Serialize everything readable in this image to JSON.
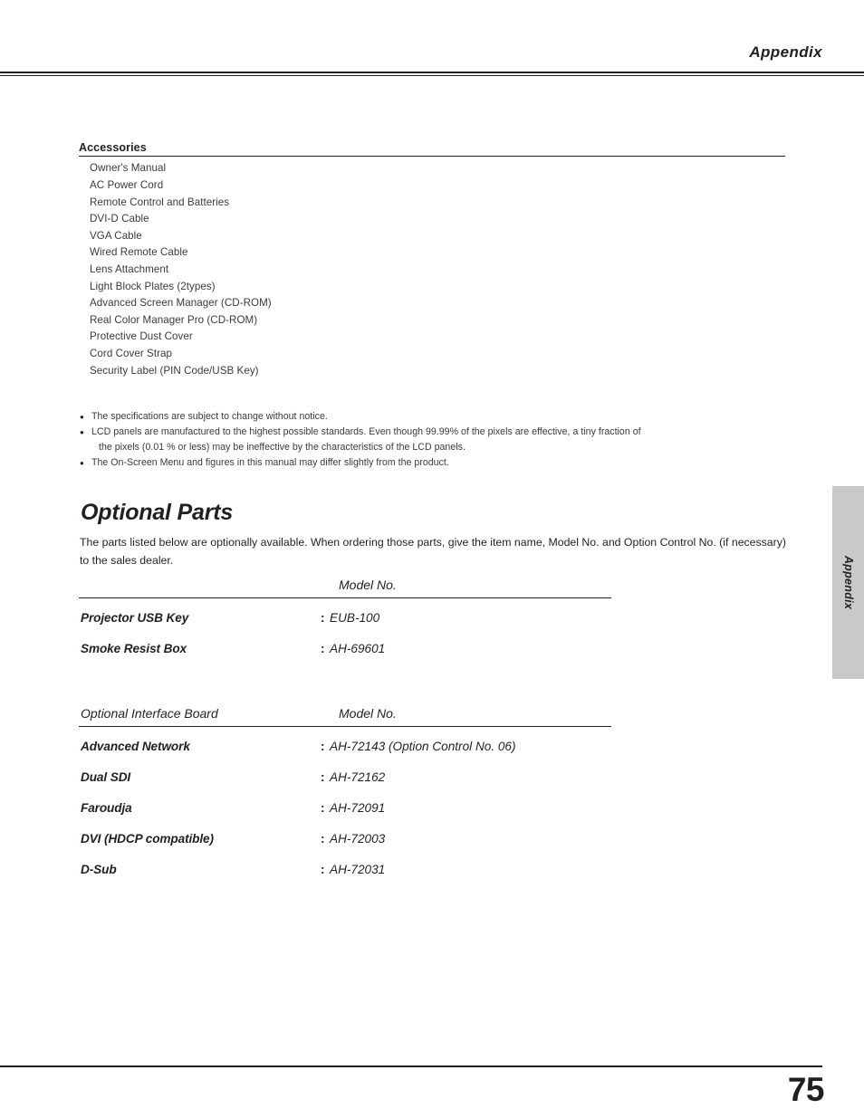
{
  "header": {
    "title": "Appendix"
  },
  "accessories": {
    "title": "Accessories",
    "items": [
      "Owner's Manual",
      "AC Power Cord",
      "Remote Control and Batteries",
      "DVI-D Cable",
      "VGA Cable",
      "Wired Remote Cable",
      "Lens Attachment",
      "Light Block Plates (2types)",
      "Advanced Screen Manager (CD-ROM)",
      "Real Color Manager Pro (CD-ROM)",
      "Protective Dust Cover",
      "Cord Cover Strap",
      "Security Label (PIN Code/USB Key)"
    ]
  },
  "notes": {
    "bullet_glyph": "●",
    "items": [
      "The specifications are subject to change without notice.",
      "LCD panels are manufactured to the highest possible standards.  Even though 99.99% of the pixels are effective,  a tiny fraction of",
      "The On-Screen Menu and figures in this manual may differ slightly from the product."
    ],
    "note2_continuation": "the pixels (0.01 % or less) may be ineffective by the characteristics of the LCD panels."
  },
  "optional_parts": {
    "title": "Optional Parts",
    "intro": "The parts listed below are optionally available.  When ordering those parts, give the item name, Model No. and Option Control No. (if necessary) to the sales dealer.",
    "table1": {
      "header_left": "",
      "header_model": "Model No.",
      "rows": [
        {
          "label": "Projector USB Key",
          "colon": ":",
          "model": "EUB-100"
        },
        {
          "label": "Smoke Resist Box",
          "colon": ":",
          "model": "AH-69601"
        }
      ]
    },
    "table2": {
      "header_left": "Optional Interface Board",
      "header_model": "Model No.",
      "rows": [
        {
          "label": "Advanced Network",
          "colon": ":",
          "model": "AH-72143  (Option Control No. 06)"
        },
        {
          "label": "Dual SDI",
          "colon": ":",
          "model": "AH-72162"
        },
        {
          "label": "Faroudja",
          "colon": ":",
          "model": "AH-72091"
        },
        {
          "label": "DVI (HDCP compatible)",
          "colon": ":",
          "model": "AH-72003"
        },
        {
          "label": "D-Sub",
          "colon": ":",
          "model": "AH-72031"
        }
      ]
    }
  },
  "side_tab": {
    "label": "Appendix",
    "color": "#c8c9ca"
  },
  "footer": {
    "page_number": "75"
  }
}
